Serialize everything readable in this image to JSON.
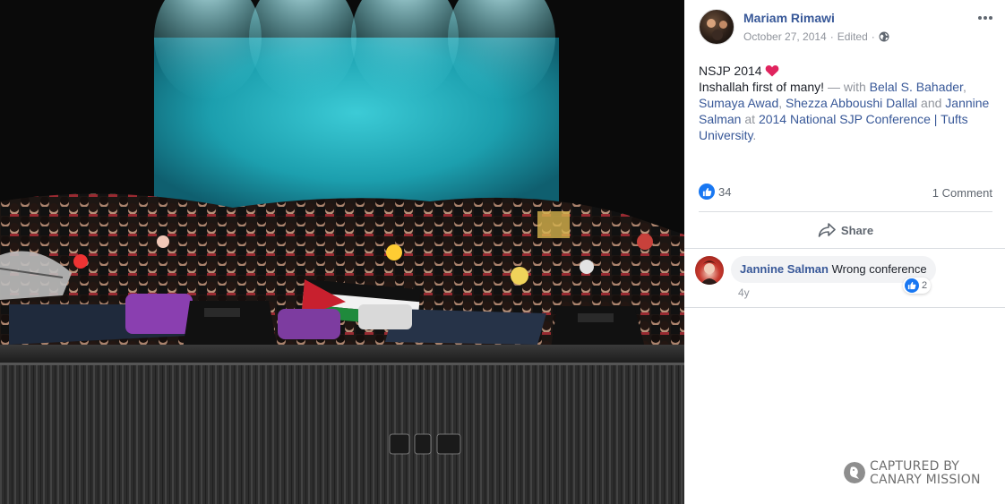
{
  "post": {
    "author": "Mariam Rimawi",
    "date": "October 27, 2014",
    "edited_label": "Edited",
    "line1": "NSJP 2014",
    "line2_start": "Inshallah first of many!",
    "with_prefix": " — with ",
    "tagged": [
      "Belal S. Bahader",
      "Sumaya Awad",
      "Shezza Abboushi Dallal",
      "Jannine Salman"
    ],
    "sep1": ", ",
    "sep2": ", ",
    "and_word": " and ",
    "at_word": " at ",
    "place": "2014 National SJP Conference | Tufts University",
    "end": "."
  },
  "reactions": {
    "like_count": "34",
    "comment_count": "1 Comment"
  },
  "actions": {
    "share_label": "Share"
  },
  "comments": [
    {
      "author": "Jannine Salman",
      "text": "Wrong conference",
      "likes": "2",
      "time": "4y"
    }
  ],
  "watermark": {
    "line1": "CAPTURED BY",
    "line2": "CANARY MISSION"
  },
  "colors": {
    "link": "#385898",
    "like_blue": "#1877f2",
    "heart": "#e0245e",
    "stage_backdrop": "#1fa5b3"
  },
  "icons": [
    "globe-icon",
    "more-icon",
    "heart-icon",
    "like-badge-icon",
    "share-icon",
    "small-like-icon",
    "watermark-logo-icon"
  ]
}
